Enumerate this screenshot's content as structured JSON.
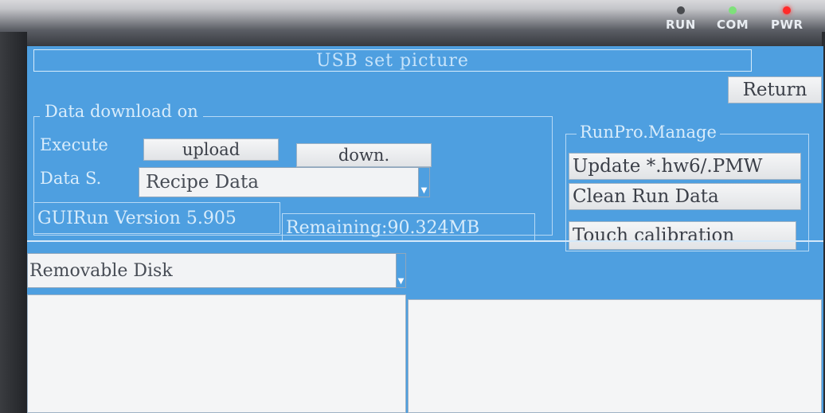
{
  "device": {
    "leds": [
      {
        "label": "RUN",
        "color": "#4a4c50"
      },
      {
        "label": "COM",
        "color": "#7ee07a"
      },
      {
        "label": "PWR",
        "color": "#ff2a2a"
      }
    ]
  },
  "screen": {
    "title": "USB set picture",
    "return_label": "Return",
    "download_group": {
      "caption": "Data download on",
      "execute_label": "Execute",
      "upload_label": "upload",
      "down_label": "down.",
      "data_source_label": "Data S.",
      "data_source_value": "Recipe Data"
    },
    "version_text": "GUIRun Version 5.905",
    "remaining_text": "Remaining:90.324MB",
    "runpro": {
      "caption": "RunPro.Manage",
      "update_label": "Update *.hw6/.PMW",
      "clean_label": "Clean Run Data",
      "touch_label": "Touch calibration"
    },
    "disk_select_value": "Removable Disk"
  },
  "colors": {
    "screen_bg": "#4e9fe0",
    "button_bg": "#ecedef",
    "pane_bg": "#f4f5f6"
  }
}
